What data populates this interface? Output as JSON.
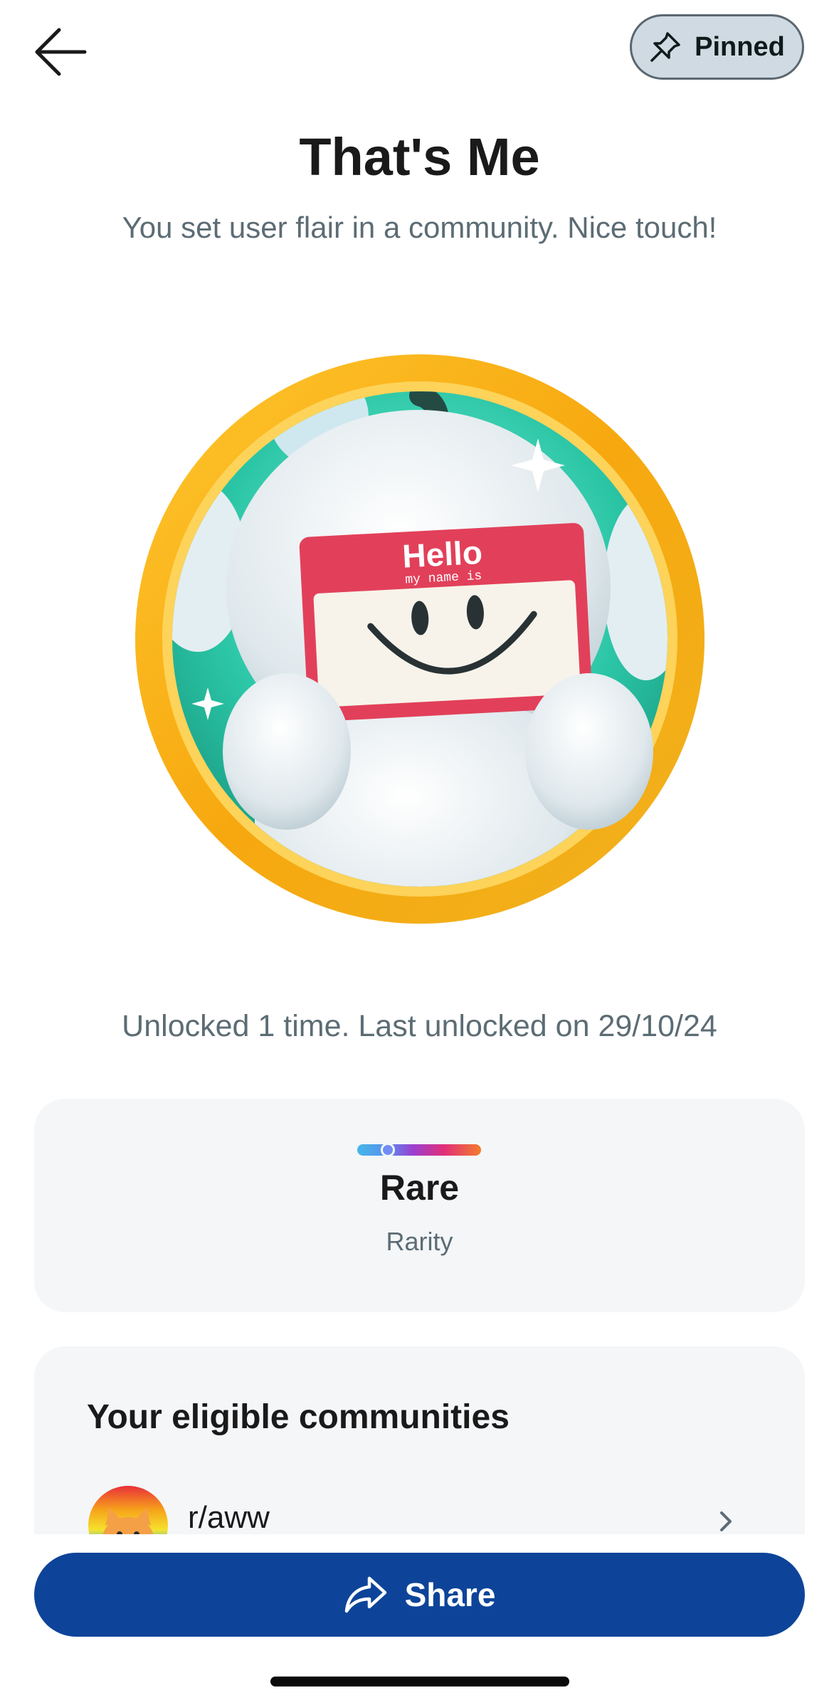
{
  "header": {
    "back_icon": "arrow-left-icon",
    "pinned_icon": "pin-icon",
    "pinned_label": "Pinned"
  },
  "achievement": {
    "title": "That's Me",
    "subtitle": "You set user flair in a community. Nice touch!",
    "badge_text_hello": "Hello",
    "badge_text_name": "my name is",
    "unlocked_text": "Unlocked 1 time. Last unlocked on 29/10/24"
  },
  "rarity": {
    "value": "Rare",
    "label": "Rarity"
  },
  "communities": {
    "title": "Your eligible communities",
    "items": [
      {
        "name": "r/aww",
        "icon": "cat-avatar-icon"
      }
    ]
  },
  "share": {
    "icon": "share-arrow-icon",
    "label": "Share"
  },
  "colors": {
    "share_button": "#0d4499",
    "badge_ring": "#f6b01c",
    "pinned_bg": "#cfdae2",
    "card_bg": "#f4f6f8"
  }
}
